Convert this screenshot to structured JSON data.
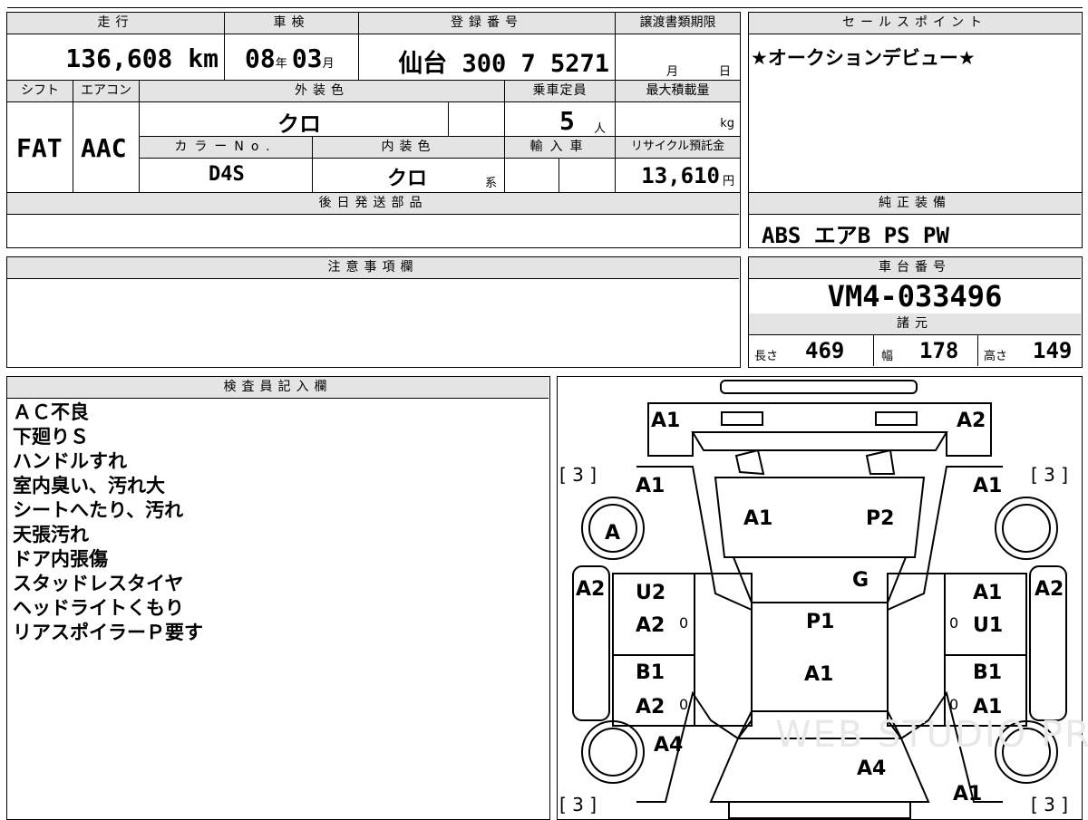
{
  "header": {
    "mileage_label": "走行",
    "mileage_value": "136,608",
    "mileage_unit": "km",
    "inspection_label": "車検",
    "inspection_year": "08",
    "inspection_year_unit": "年",
    "inspection_month": "03",
    "inspection_month_unit": "月",
    "registration_label": "登録番号",
    "registration_value": "仙台 300 7 5271",
    "transfer_deadline_label": "譲渡書類期限",
    "transfer_month_unit": "月",
    "transfer_day_unit": "日"
  },
  "vehicle": {
    "shift_label": "シフト",
    "shift_value": "FAT",
    "aircon_label": "エアコン",
    "aircon_value": "AAC",
    "exterior_color_label": "外装色",
    "exterior_color_value": "クロ",
    "capacity_label": "乗車定員",
    "capacity_value": "5",
    "capacity_unit": "人",
    "max_load_label": "最大積載量",
    "max_load_unit": "kg",
    "color_no_label": "カラーNo.",
    "color_no_value": "D4S",
    "interior_color_label": "内装色",
    "interior_color_value": "クロ",
    "interior_color_suffix": "系",
    "import_label": "輸入車",
    "recycle_label": "リサイクル預託金",
    "recycle_value": "13,610",
    "recycle_unit": "円"
  },
  "sales_point": {
    "label": "セールスポイント",
    "value": "★オークションデビュー★"
  },
  "later_parts": {
    "label": "後日発送部品",
    "value": ""
  },
  "genuine_equipment": {
    "label": "純正装備",
    "value": "ABS エアB PS PW"
  },
  "notes": {
    "label": "注意事項欄",
    "value": ""
  },
  "chassis": {
    "label": "車台番号",
    "value": "VM4-033496"
  },
  "specs": {
    "label": "諸元",
    "length_label": "長さ",
    "length_value": "469",
    "width_label": "幅",
    "width_value": "178",
    "height_label": "高さ",
    "height_value": "149"
  },
  "inspector": {
    "label": "検査員記入欄",
    "lines": [
      "ＡＣ不良",
      "下廻りＳ",
      "ハンドルすれ",
      "室内臭い、汚れ大",
      "シートへたり、汚れ",
      "天張汚れ",
      "ドア内張傷",
      "スタッドレスタイヤ",
      "ヘッドライトくもり",
      "リアスポイラーＰ要す"
    ]
  },
  "diagram": {
    "watermark": "WEB STUDIO PRO",
    "tread_front_left": "[ 3 ]",
    "tread_front_right": "[ 3 ]",
    "tread_rear_left": "[ 3 ]",
    "tread_rear_right": "[ 3 ]",
    "hood_left": "A1",
    "hood_right": "A2",
    "front_fender_left": "A1",
    "front_fender_right": "A1",
    "windshield_left": "A1",
    "windshield_right": "P2",
    "front_wheel_left": "A",
    "roof_front": "G",
    "pillar_left": "A2",
    "pillar_right": "A2",
    "front_door_left_top": "U2",
    "front_door_left_bottom": "A2",
    "front_door_right_top": "A1",
    "front_door_right_bottom": "U1",
    "roof_center": "P1",
    "roof_rear": "A1",
    "rear_door_left_top": "B1",
    "rear_door_left_bottom": "A2",
    "rear_door_right_top": "B1",
    "rear_door_right_bottom": "A1",
    "rear_quarter_left": "A4",
    "trunk": "A4",
    "rear_quarter_right": "A1",
    "door_handle_mark": "0"
  }
}
